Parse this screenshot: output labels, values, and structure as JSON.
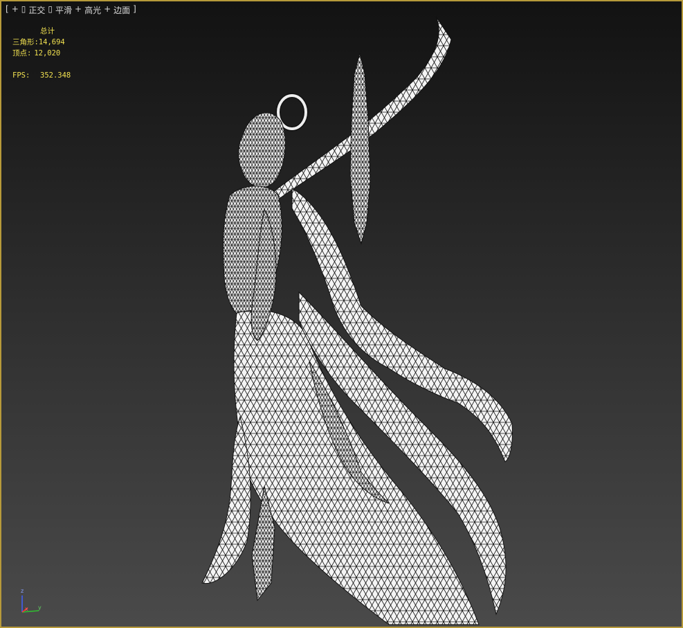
{
  "viewport_menu": {
    "open": "[",
    "plus1": "+",
    "sep1": "▯",
    "view": "正交",
    "sep2": "▯",
    "shading": "平滑",
    "plus2": "+",
    "highlight": "高光",
    "plus3": "+",
    "edges": "边面",
    "close": "]"
  },
  "stats": {
    "header": "总计",
    "triangles_label": "三角形:",
    "triangles_value": "14,694",
    "vertices_label": "顶点:",
    "vertices_value": "12,020",
    "fps_label": "FPS:",
    "fps_value": "352.348"
  },
  "gizmo": {
    "z_label": "z",
    "x_label": "x",
    "y_label": "y",
    "colors": {
      "z": "#4060ff",
      "x": "#ff3030",
      "y": "#30c030"
    }
  },
  "colors": {
    "border": "#b79a3a",
    "stats_text": "#f0e050",
    "mesh_fill": "#f4f4f4",
    "mesh_wire": "#111111"
  }
}
